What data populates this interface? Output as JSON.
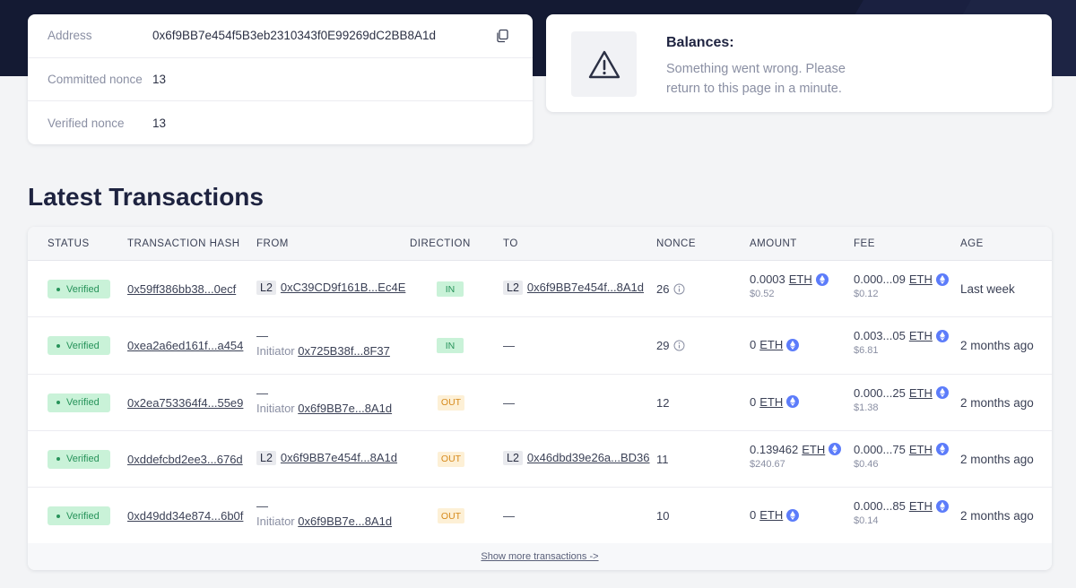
{
  "account": {
    "address_label": "Address",
    "address": "0x6f9BB7e454f5B3eb2310343f0E99269dC2BB8A1d",
    "committed_label": "Committed nonce",
    "committed_nonce": "13",
    "verified_label": "Verified nonce",
    "verified_nonce": "13"
  },
  "balances": {
    "title": "Balances:",
    "message": "Something went wrong. Please return to this page in a minute."
  },
  "transactions": {
    "title": "Latest Transactions",
    "headers": {
      "status": "STATUS",
      "hash": "TRANSACTION HASH",
      "from": "FROM",
      "direction": "DIRECTION",
      "to": "TO",
      "nonce": "NONCE",
      "amount": "AMOUNT",
      "fee": "FEE",
      "age": "AGE"
    },
    "rows": [
      {
        "status": "Verified",
        "hash": "0x59ff386bb38...0ecf",
        "from_l2": "L2",
        "from_addr": "0xC39CD9f161B...Ec4E",
        "direction": "IN",
        "to_l2": "L2",
        "to_addr": "0x6f9BB7e454f...8A1d",
        "nonce": "26",
        "amount": "0.0003",
        "amount_token": "ETH",
        "amount_usd": "$0.52",
        "fee": "0.000...09",
        "fee_token": "ETH",
        "fee_usd": "$0.12",
        "age": "Last week"
      },
      {
        "status": "Verified",
        "hash": "0xea2a6ed161f...a454",
        "from_dash": "—",
        "initiator_label": "Initiator",
        "initiator_addr": "0x725B38f...8F37",
        "direction": "IN",
        "to_dash": "—",
        "nonce": "29",
        "amount": "0",
        "amount_token": "ETH",
        "fee": "0.003...05",
        "fee_token": "ETH",
        "fee_usd": "$6.81",
        "age": "2 months ago"
      },
      {
        "status": "Verified",
        "hash": "0x2ea753364f4...55e9",
        "from_dash": "—",
        "initiator_label": "Initiator",
        "initiator_addr": "0x6f9BB7e...8A1d",
        "direction": "OUT",
        "to_dash": "—",
        "nonce": "12",
        "amount": "0",
        "amount_token": "ETH",
        "fee": "0.000...25",
        "fee_token": "ETH",
        "fee_usd": "$1.38",
        "age": "2 months ago"
      },
      {
        "status": "Verified",
        "hash": "0xddefcbd2ee3...676d",
        "from_l2": "L2",
        "from_addr": "0x6f9BB7e454f...8A1d",
        "direction": "OUT",
        "to_l2": "L2",
        "to_addr": "0x46dbd39e26a...BD36",
        "nonce": "11",
        "amount": "0.139462",
        "amount_token": "ETH",
        "amount_usd": "$240.67",
        "fee": "0.000...75",
        "fee_token": "ETH",
        "fee_usd": "$0.46",
        "age": "2 months ago"
      },
      {
        "status": "Verified",
        "hash": "0xd49dd34e874...6b0f",
        "from_dash": "—",
        "initiator_label": "Initiator",
        "initiator_addr": "0x6f9BB7e...8A1d",
        "direction": "OUT",
        "to_dash": "—",
        "nonce": "10",
        "amount": "0",
        "amount_token": "ETH",
        "fee": "0.000...85",
        "fee_token": "ETH",
        "fee_usd": "$0.14",
        "age": "2 months ago"
      }
    ],
    "show_more": "Show more transactions ->"
  },
  "colors": {
    "hero": "#141a33",
    "verified_bg": "#c9f2d8",
    "verified_text": "#27935a",
    "out_bg": "#fdf0d6",
    "out_text": "#d68a1d",
    "eth_icon": "#5c7cfa"
  },
  "icons": {
    "copy": "copy-icon",
    "warning": "warning-triangle-icon",
    "info": "info-icon",
    "eth": "eth-token-icon"
  }
}
